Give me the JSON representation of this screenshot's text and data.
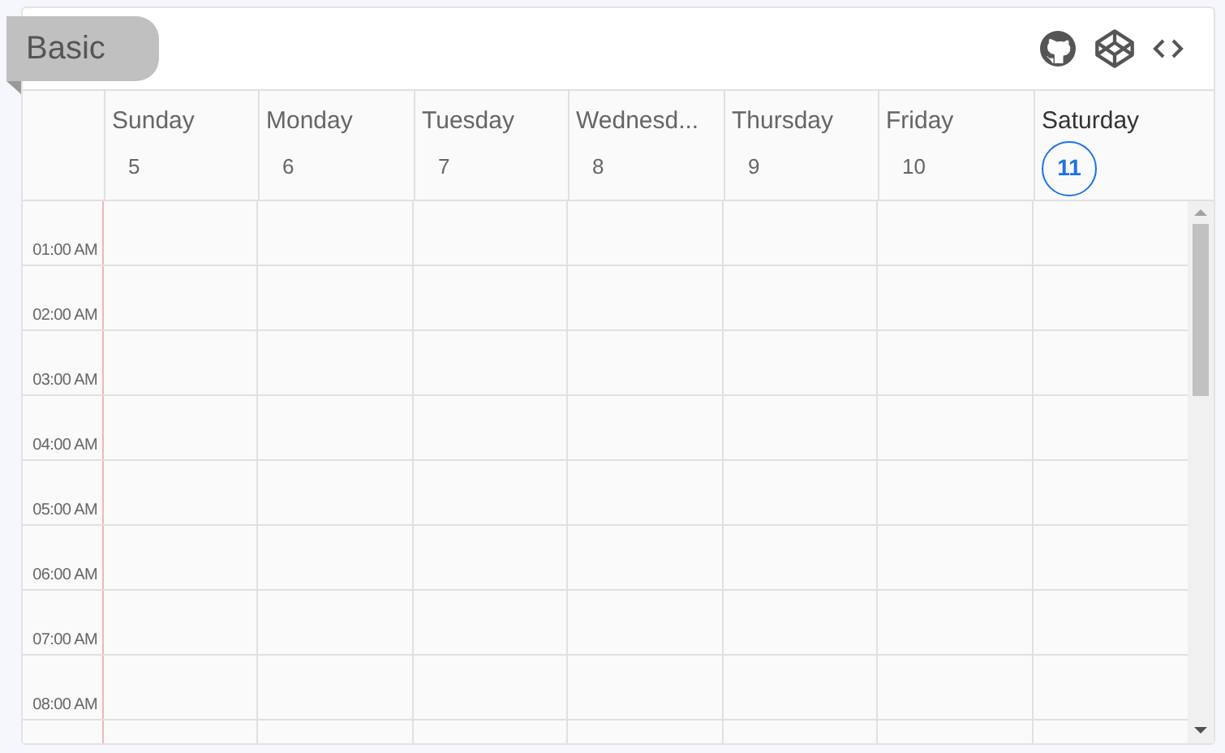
{
  "title": "Basic",
  "toolbar": {
    "buttons": [
      {
        "kind": "github"
      },
      {
        "kind": "codepen"
      },
      {
        "kind": "code"
      }
    ]
  },
  "days": [
    {
      "name": "Sunday",
      "date": "5",
      "selected": false
    },
    {
      "name": "Monday",
      "date": "6",
      "selected": false
    },
    {
      "name": "Tuesday",
      "date": "7",
      "selected": false
    },
    {
      "name": "Wednesd...",
      "date": "8",
      "selected": false
    },
    {
      "name": "Thursday",
      "date": "9",
      "selected": false
    },
    {
      "name": "Friday",
      "date": "10",
      "selected": false
    },
    {
      "name": "Saturday",
      "date": "11",
      "selected": true
    }
  ],
  "time_slots": [
    "01:00 AM",
    "02:00 AM",
    "03:00 AM",
    "04:00 AM",
    "05:00 AM",
    "06:00 AM",
    "07:00 AM",
    "08:00 AM"
  ]
}
